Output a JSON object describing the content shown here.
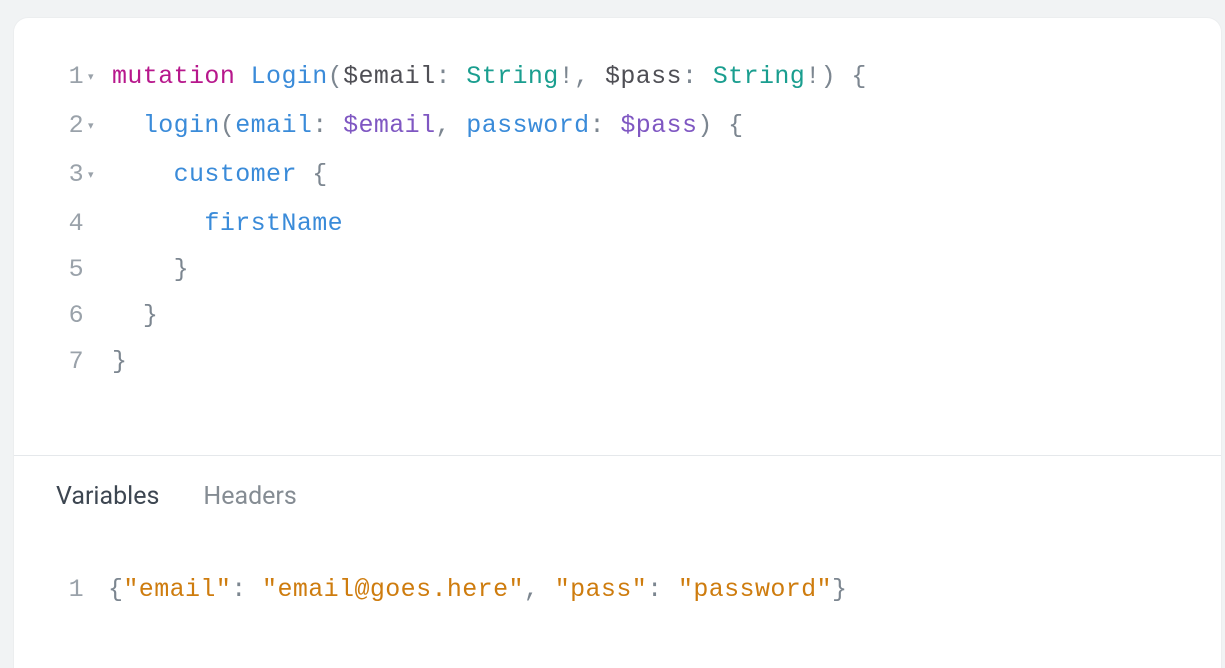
{
  "query_editor": {
    "lines": [
      {
        "n": "1",
        "fold": "▾",
        "tokens": [
          {
            "cls": "tok-keyword",
            "t": "mutation"
          },
          {
            "cls": "",
            "t": " "
          },
          {
            "cls": "tok-opname",
            "t": "Login"
          },
          {
            "cls": "tok-paren",
            "t": "("
          },
          {
            "cls": "tok-var",
            "t": "$email"
          },
          {
            "cls": "tok-colon",
            "t": ":"
          },
          {
            "cls": "",
            "t": " "
          },
          {
            "cls": "tok-type",
            "t": "String"
          },
          {
            "cls": "tok-bang",
            "t": "!"
          },
          {
            "cls": "tok-comma",
            "t": ","
          },
          {
            "cls": "",
            "t": " "
          },
          {
            "cls": "tok-var",
            "t": "$pass"
          },
          {
            "cls": "tok-colon",
            "t": ":"
          },
          {
            "cls": "",
            "t": " "
          },
          {
            "cls": "tok-type",
            "t": "String"
          },
          {
            "cls": "tok-bang",
            "t": "!"
          },
          {
            "cls": "tok-paren",
            "t": ")"
          },
          {
            "cls": "",
            "t": " "
          },
          {
            "cls": "tok-brace",
            "t": "{"
          }
        ]
      },
      {
        "n": "2",
        "fold": "▾",
        "tokens": [
          {
            "cls": "",
            "t": "  "
          },
          {
            "cls": "tok-fieldcall",
            "t": "login"
          },
          {
            "cls": "tok-paren",
            "t": "("
          },
          {
            "cls": "tok-argname",
            "t": "email"
          },
          {
            "cls": "tok-colon",
            "t": ":"
          },
          {
            "cls": "",
            "t": " "
          },
          {
            "cls": "tok-argvar",
            "t": "$email"
          },
          {
            "cls": "tok-comma",
            "t": ","
          },
          {
            "cls": "",
            "t": " "
          },
          {
            "cls": "tok-argname",
            "t": "password"
          },
          {
            "cls": "tok-colon",
            "t": ":"
          },
          {
            "cls": "",
            "t": " "
          },
          {
            "cls": "tok-argvar",
            "t": "$pass"
          },
          {
            "cls": "tok-paren",
            "t": ")"
          },
          {
            "cls": "",
            "t": " "
          },
          {
            "cls": "tok-brace",
            "t": "{"
          }
        ]
      },
      {
        "n": "3",
        "fold": "▾",
        "tokens": [
          {
            "cls": "",
            "t": "    "
          },
          {
            "cls": "tok-selfield",
            "t": "customer"
          },
          {
            "cls": "",
            "t": " "
          },
          {
            "cls": "tok-brace",
            "t": "{"
          }
        ]
      },
      {
        "n": "4",
        "fold": "",
        "tokens": [
          {
            "cls": "",
            "t": "      "
          },
          {
            "cls": "tok-leaf",
            "t": "firstName"
          }
        ]
      },
      {
        "n": "5",
        "fold": "",
        "tokens": [
          {
            "cls": "",
            "t": "    "
          },
          {
            "cls": "tok-brace",
            "t": "}"
          }
        ]
      },
      {
        "n": "6",
        "fold": "",
        "tokens": [
          {
            "cls": "",
            "t": "  "
          },
          {
            "cls": "tok-brace",
            "t": "}"
          }
        ]
      },
      {
        "n": "7",
        "fold": "",
        "tokens": [
          {
            "cls": "tok-brace",
            "t": "}"
          }
        ]
      }
    ]
  },
  "tabs": {
    "variables_label": "Variables",
    "headers_label": "Headers",
    "active": "variables"
  },
  "variables_editor": {
    "line_number": "1",
    "tokens": [
      {
        "cls": "j-brace",
        "t": "{"
      },
      {
        "cls": "j-key",
        "t": "\"email\""
      },
      {
        "cls": "j-colon",
        "t": ":"
      },
      {
        "cls": "",
        "t": " "
      },
      {
        "cls": "j-string",
        "t": "\"email@goes.here\""
      },
      {
        "cls": "j-comma",
        "t": ","
      },
      {
        "cls": "",
        "t": " "
      },
      {
        "cls": "j-key",
        "t": "\"pass\""
      },
      {
        "cls": "j-colon",
        "t": ":"
      },
      {
        "cls": "",
        "t": " "
      },
      {
        "cls": "j-string",
        "t": "\"password\""
      },
      {
        "cls": "j-brace",
        "t": "}"
      }
    ]
  }
}
